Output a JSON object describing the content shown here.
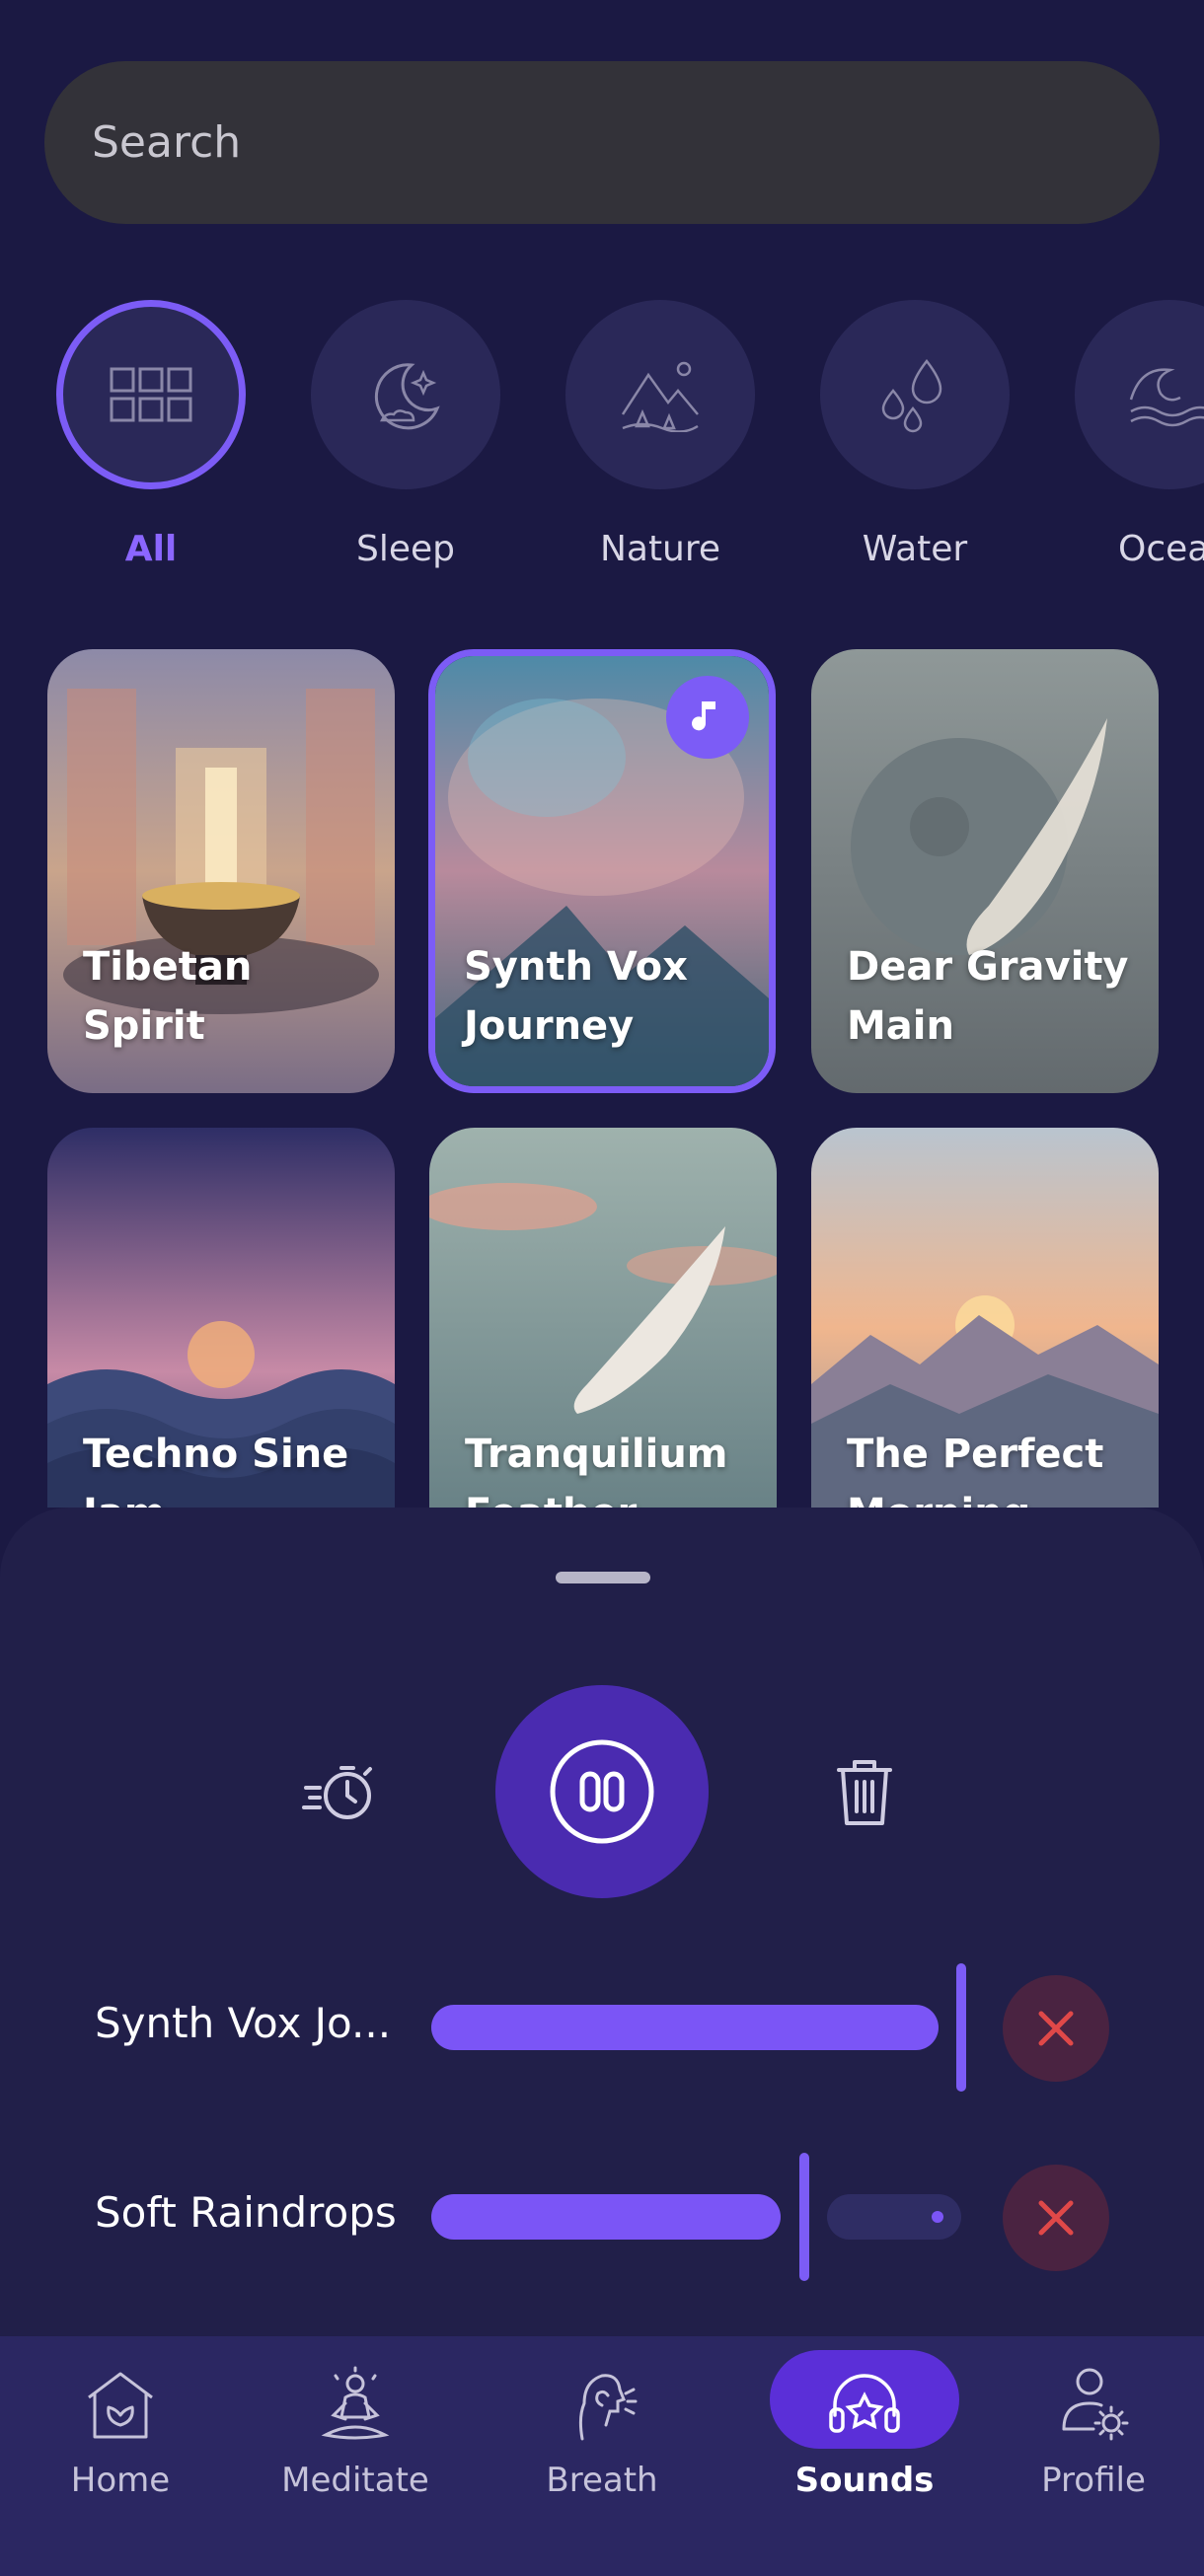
{
  "search": {
    "placeholder": "Search"
  },
  "categories": [
    {
      "label": "All",
      "icon": "grid-icon",
      "active": true
    },
    {
      "label": "Sleep",
      "icon": "moon-stars-icon"
    },
    {
      "label": "Nature",
      "icon": "mountains-icon"
    },
    {
      "label": "Water",
      "icon": "water-drops-icon"
    },
    {
      "label": "Ocea",
      "icon": "wave-icon"
    }
  ],
  "cards": [
    {
      "title": "Tibetan Spirit"
    },
    {
      "title": "Synth Vox Journey",
      "selected": true,
      "badge_icon": "music-note-icon"
    },
    {
      "title": "Dear Gravity Main"
    },
    {
      "title": "Techno Sine Jam"
    },
    {
      "title": "Tranquilium Feather"
    },
    {
      "title": "The Perfect Morning"
    }
  ],
  "player": {
    "timer_icon": "timer-icon",
    "pause_icon": "pause-icon",
    "delete_icon": "trash-icon"
  },
  "mix": [
    {
      "label": "Synth Vox Jo...",
      "volume": 1.0
    },
    {
      "label": "Soft Raindrops",
      "volume": 0.7
    }
  ],
  "nav": [
    {
      "label": "Home",
      "icon": "home-icon"
    },
    {
      "label": "Meditate",
      "icon": "meditate-icon"
    },
    {
      "label": "Breath",
      "icon": "breath-icon"
    },
    {
      "label": "Sounds",
      "icon": "headphones-icon",
      "active": true
    },
    {
      "label": "Profile",
      "icon": "profile-settings-icon"
    }
  ],
  "colors": {
    "background": "#1b1943",
    "accent": "#7c5cf6",
    "sheet": "#211f49",
    "nav": "#2b2762",
    "delete": "#e04848"
  }
}
